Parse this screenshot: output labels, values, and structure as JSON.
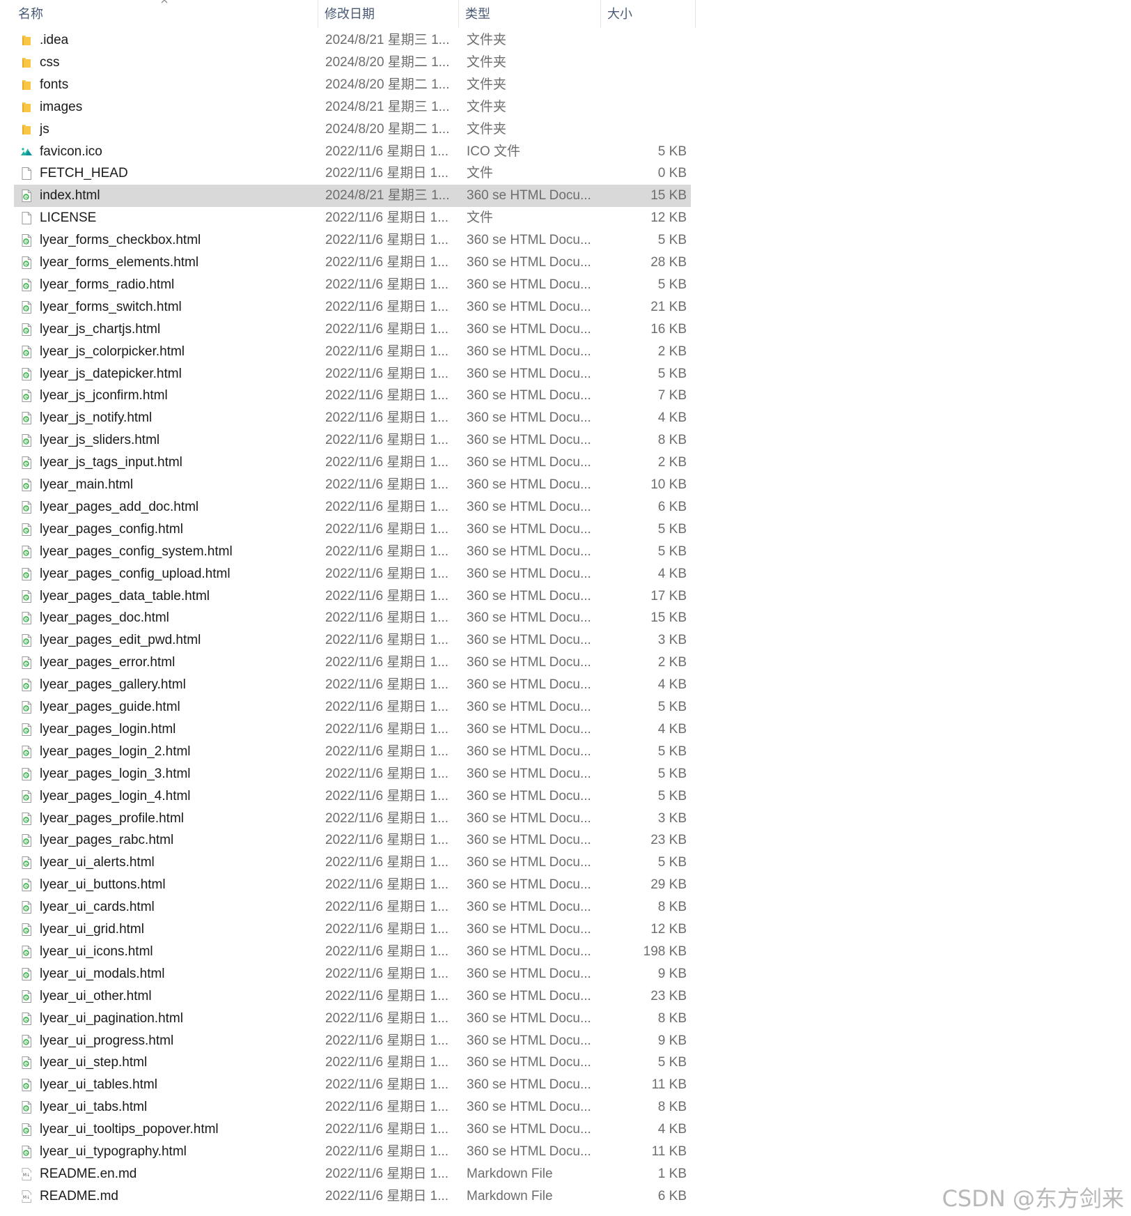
{
  "header": {
    "name_label": "名称",
    "date_label": "修改日期",
    "type_label": "类型",
    "size_label": "大小",
    "sort_icon": "chevron-up-icon"
  },
  "colors": {
    "folder": "#f8c545",
    "html_icon_green": "#3cb44b",
    "selected_row": "#d9d9d9",
    "header_text": "#4a5a75"
  },
  "files": [
    {
      "name": ".idea",
      "date": "2024/8/21 星期三 1...",
      "type": "文件夹",
      "size": "",
      "icon": "folder-icon"
    },
    {
      "name": "css",
      "date": "2024/8/20 星期二 1...",
      "type": "文件夹",
      "size": "",
      "icon": "folder-icon"
    },
    {
      "name": "fonts",
      "date": "2024/8/20 星期二 1...",
      "type": "文件夹",
      "size": "",
      "icon": "folder-icon"
    },
    {
      "name": "images",
      "date": "2024/8/21 星期三 1...",
      "type": "文件夹",
      "size": "",
      "icon": "folder-icon"
    },
    {
      "name": "js",
      "date": "2024/8/20 星期二 1...",
      "type": "文件夹",
      "size": "",
      "icon": "folder-icon"
    },
    {
      "name": "favicon.ico",
      "date": "2022/11/6 星期日 1...",
      "type": "ICO 文件",
      "size": "5 KB",
      "icon": "ico-file-icon"
    },
    {
      "name": "FETCH_HEAD",
      "date": "2022/11/6 星期日 1...",
      "type": "文件",
      "size": "0 KB",
      "icon": "file-icon"
    },
    {
      "name": "index.html",
      "date": "2024/8/21 星期三 1...",
      "type": "360 se HTML Docu...",
      "size": "15 KB",
      "icon": "html-file-icon",
      "selected": true
    },
    {
      "name": "LICENSE",
      "date": "2022/11/6 星期日 1...",
      "type": "文件",
      "size": "12 KB",
      "icon": "file-icon"
    },
    {
      "name": "lyear_forms_checkbox.html",
      "date": "2022/11/6 星期日 1...",
      "type": "360 se HTML Docu...",
      "size": "5 KB",
      "icon": "html-file-icon"
    },
    {
      "name": "lyear_forms_elements.html",
      "date": "2022/11/6 星期日 1...",
      "type": "360 se HTML Docu...",
      "size": "28 KB",
      "icon": "html-file-icon"
    },
    {
      "name": "lyear_forms_radio.html",
      "date": "2022/11/6 星期日 1...",
      "type": "360 se HTML Docu...",
      "size": "5 KB",
      "icon": "html-file-icon"
    },
    {
      "name": "lyear_forms_switch.html",
      "date": "2022/11/6 星期日 1...",
      "type": "360 se HTML Docu...",
      "size": "21 KB",
      "icon": "html-file-icon"
    },
    {
      "name": "lyear_js_chartjs.html",
      "date": "2022/11/6 星期日 1...",
      "type": "360 se HTML Docu...",
      "size": "16 KB",
      "icon": "html-file-icon"
    },
    {
      "name": "lyear_js_colorpicker.html",
      "date": "2022/11/6 星期日 1...",
      "type": "360 se HTML Docu...",
      "size": "2 KB",
      "icon": "html-file-icon"
    },
    {
      "name": "lyear_js_datepicker.html",
      "date": "2022/11/6 星期日 1...",
      "type": "360 se HTML Docu...",
      "size": "5 KB",
      "icon": "html-file-icon"
    },
    {
      "name": "lyear_js_jconfirm.html",
      "date": "2022/11/6 星期日 1...",
      "type": "360 se HTML Docu...",
      "size": "7 KB",
      "icon": "html-file-icon"
    },
    {
      "name": "lyear_js_notify.html",
      "date": "2022/11/6 星期日 1...",
      "type": "360 se HTML Docu...",
      "size": "4 KB",
      "icon": "html-file-icon"
    },
    {
      "name": "lyear_js_sliders.html",
      "date": "2022/11/6 星期日 1...",
      "type": "360 se HTML Docu...",
      "size": "8 KB",
      "icon": "html-file-icon"
    },
    {
      "name": "lyear_js_tags_input.html",
      "date": "2022/11/6 星期日 1...",
      "type": "360 se HTML Docu...",
      "size": "2 KB",
      "icon": "html-file-icon"
    },
    {
      "name": "lyear_main.html",
      "date": "2022/11/6 星期日 1...",
      "type": "360 se HTML Docu...",
      "size": "10 KB",
      "icon": "html-file-icon"
    },
    {
      "name": "lyear_pages_add_doc.html",
      "date": "2022/11/6 星期日 1...",
      "type": "360 se HTML Docu...",
      "size": "6 KB",
      "icon": "html-file-icon"
    },
    {
      "name": "lyear_pages_config.html",
      "date": "2022/11/6 星期日 1...",
      "type": "360 se HTML Docu...",
      "size": "5 KB",
      "icon": "html-file-icon"
    },
    {
      "name": "lyear_pages_config_system.html",
      "date": "2022/11/6 星期日 1...",
      "type": "360 se HTML Docu...",
      "size": "5 KB",
      "icon": "html-file-icon"
    },
    {
      "name": "lyear_pages_config_upload.html",
      "date": "2022/11/6 星期日 1...",
      "type": "360 se HTML Docu...",
      "size": "4 KB",
      "icon": "html-file-icon"
    },
    {
      "name": "lyear_pages_data_table.html",
      "date": "2022/11/6 星期日 1...",
      "type": "360 se HTML Docu...",
      "size": "17 KB",
      "icon": "html-file-icon"
    },
    {
      "name": "lyear_pages_doc.html",
      "date": "2022/11/6 星期日 1...",
      "type": "360 se HTML Docu...",
      "size": "15 KB",
      "icon": "html-file-icon"
    },
    {
      "name": "lyear_pages_edit_pwd.html",
      "date": "2022/11/6 星期日 1...",
      "type": "360 se HTML Docu...",
      "size": "3 KB",
      "icon": "html-file-icon"
    },
    {
      "name": "lyear_pages_error.html",
      "date": "2022/11/6 星期日 1...",
      "type": "360 se HTML Docu...",
      "size": "2 KB",
      "icon": "html-file-icon"
    },
    {
      "name": "lyear_pages_gallery.html",
      "date": "2022/11/6 星期日 1...",
      "type": "360 se HTML Docu...",
      "size": "4 KB",
      "icon": "html-file-icon"
    },
    {
      "name": "lyear_pages_guide.html",
      "date": "2022/11/6 星期日 1...",
      "type": "360 se HTML Docu...",
      "size": "5 KB",
      "icon": "html-file-icon"
    },
    {
      "name": "lyear_pages_login.html",
      "date": "2022/11/6 星期日 1...",
      "type": "360 se HTML Docu...",
      "size": "4 KB",
      "icon": "html-file-icon"
    },
    {
      "name": "lyear_pages_login_2.html",
      "date": "2022/11/6 星期日 1...",
      "type": "360 se HTML Docu...",
      "size": "5 KB",
      "icon": "html-file-icon"
    },
    {
      "name": "lyear_pages_login_3.html",
      "date": "2022/11/6 星期日 1...",
      "type": "360 se HTML Docu...",
      "size": "5 KB",
      "icon": "html-file-icon"
    },
    {
      "name": "lyear_pages_login_4.html",
      "date": "2022/11/6 星期日 1...",
      "type": "360 se HTML Docu...",
      "size": "5 KB",
      "icon": "html-file-icon"
    },
    {
      "name": "lyear_pages_profile.html",
      "date": "2022/11/6 星期日 1...",
      "type": "360 se HTML Docu...",
      "size": "3 KB",
      "icon": "html-file-icon"
    },
    {
      "name": "lyear_pages_rabc.html",
      "date": "2022/11/6 星期日 1...",
      "type": "360 se HTML Docu...",
      "size": "23 KB",
      "icon": "html-file-icon"
    },
    {
      "name": "lyear_ui_alerts.html",
      "date": "2022/11/6 星期日 1...",
      "type": "360 se HTML Docu...",
      "size": "5 KB",
      "icon": "html-file-icon"
    },
    {
      "name": "lyear_ui_buttons.html",
      "date": "2022/11/6 星期日 1...",
      "type": "360 se HTML Docu...",
      "size": "29 KB",
      "icon": "html-file-icon"
    },
    {
      "name": "lyear_ui_cards.html",
      "date": "2022/11/6 星期日 1...",
      "type": "360 se HTML Docu...",
      "size": "8 KB",
      "icon": "html-file-icon"
    },
    {
      "name": "lyear_ui_grid.html",
      "date": "2022/11/6 星期日 1...",
      "type": "360 se HTML Docu...",
      "size": "12 KB",
      "icon": "html-file-icon"
    },
    {
      "name": "lyear_ui_icons.html",
      "date": "2022/11/6 星期日 1...",
      "type": "360 se HTML Docu...",
      "size": "198 KB",
      "icon": "html-file-icon"
    },
    {
      "name": "lyear_ui_modals.html",
      "date": "2022/11/6 星期日 1...",
      "type": "360 se HTML Docu...",
      "size": "9 KB",
      "icon": "html-file-icon"
    },
    {
      "name": "lyear_ui_other.html",
      "date": "2022/11/6 星期日 1...",
      "type": "360 se HTML Docu...",
      "size": "23 KB",
      "icon": "html-file-icon"
    },
    {
      "name": "lyear_ui_pagination.html",
      "date": "2022/11/6 星期日 1...",
      "type": "360 se HTML Docu...",
      "size": "8 KB",
      "icon": "html-file-icon"
    },
    {
      "name": "lyear_ui_progress.html",
      "date": "2022/11/6 星期日 1...",
      "type": "360 se HTML Docu...",
      "size": "9 KB",
      "icon": "html-file-icon"
    },
    {
      "name": "lyear_ui_step.html",
      "date": "2022/11/6 星期日 1...",
      "type": "360 se HTML Docu...",
      "size": "5 KB",
      "icon": "html-file-icon"
    },
    {
      "name": "lyear_ui_tables.html",
      "date": "2022/11/6 星期日 1...",
      "type": "360 se HTML Docu...",
      "size": "11 KB",
      "icon": "html-file-icon"
    },
    {
      "name": "lyear_ui_tabs.html",
      "date": "2022/11/6 星期日 1...",
      "type": "360 se HTML Docu...",
      "size": "8 KB",
      "icon": "html-file-icon"
    },
    {
      "name": "lyear_ui_tooltips_popover.html",
      "date": "2022/11/6 星期日 1...",
      "type": "360 se HTML Docu...",
      "size": "4 KB",
      "icon": "html-file-icon"
    },
    {
      "name": "lyear_ui_typography.html",
      "date": "2022/11/6 星期日 1...",
      "type": "360 se HTML Docu...",
      "size": "11 KB",
      "icon": "html-file-icon"
    },
    {
      "name": "README.en.md",
      "date": "2022/11/6 星期日 1...",
      "type": "Markdown File",
      "size": "1 KB",
      "icon": "markdown-file-icon"
    },
    {
      "name": "README.md",
      "date": "2022/11/6 星期日 1...",
      "type": "Markdown File",
      "size": "6 KB",
      "icon": "markdown-file-icon"
    }
  ],
  "watermark": "CSDN @东方剑来"
}
